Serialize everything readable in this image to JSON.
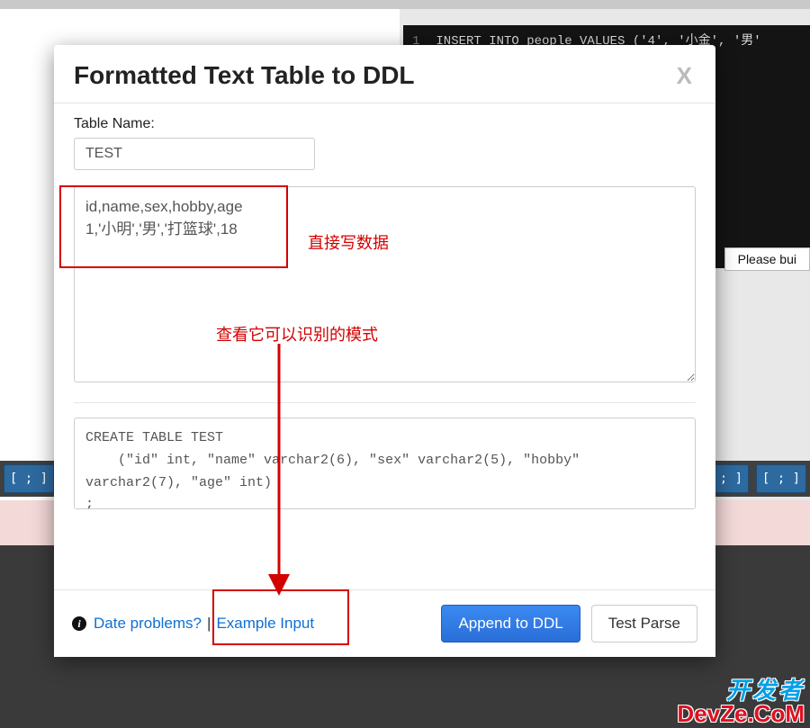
{
  "background": {
    "code_line_number": "1",
    "code_line": "INSERT INTO people VALUES ('4', '小金', '男'",
    "right_button": "Please bui",
    "toolbar_glyph": "[ ; ] ▾"
  },
  "modal": {
    "title": "Formatted Text Table to DDL",
    "close_glyph": "X",
    "table_name_label": "Table Name:",
    "table_name_value": "TEST",
    "data_input": "id,name,sex,hobby,age\n1,'小明','男','打篮球',18",
    "output_text": "CREATE TABLE TEST\n    (\"id\" int, \"name\" varchar2(6), \"sex\" varchar2(5), \"hobby\" varchar2(7), \"age\" int)\n;",
    "footer": {
      "date_problems": "Date problems?",
      "separator": "|",
      "example_input": "Example Input",
      "append_btn": "Append to DDL",
      "testparse_btn": "Test Parse"
    }
  },
  "annotations": {
    "note1": "直接写数据",
    "note2": "查看它可以识别的模式"
  },
  "watermark": {
    "line1": "开发者",
    "line2": "DevZe.CoM"
  }
}
